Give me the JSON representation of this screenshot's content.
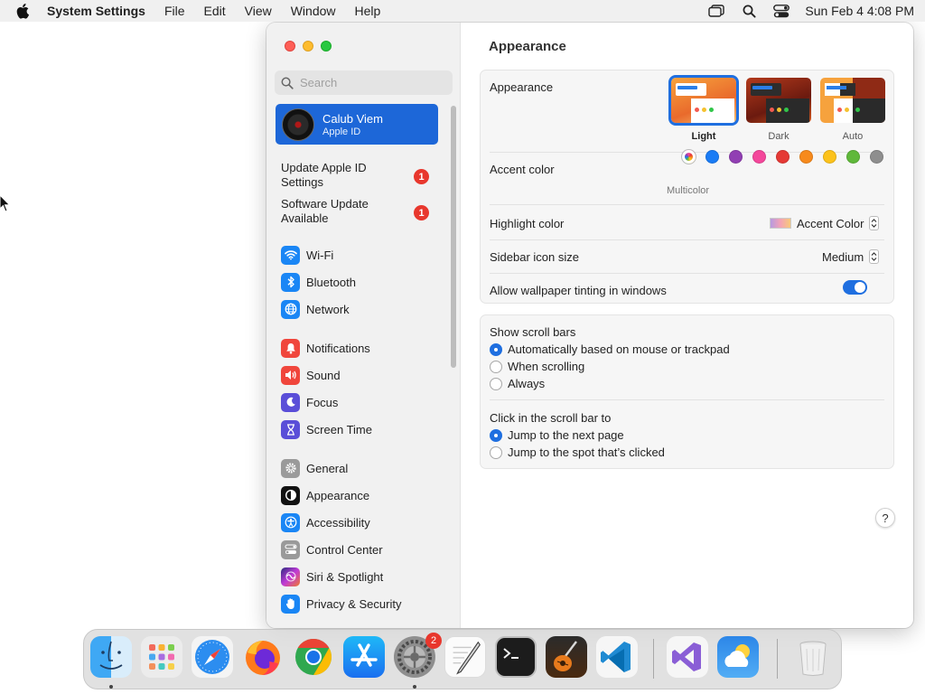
{
  "menubar": {
    "app_name": "System Settings",
    "menus": [
      "File",
      "Edit",
      "View",
      "Window",
      "Help"
    ],
    "clock": "Sun Feb 4  4:08 PM"
  },
  "sidebar": {
    "search_placeholder": "Search",
    "account": {
      "name": "Calub Viem",
      "subtitle": "Apple ID"
    },
    "notices": [
      {
        "label": "Update Apple ID Settings",
        "badge": "1"
      },
      {
        "label": "Software Update Available",
        "badge": "1"
      }
    ],
    "items": [
      {
        "label": "Wi-Fi",
        "icon": "wifi-icon",
        "color": "#1a86f5"
      },
      {
        "label": "Bluetooth",
        "icon": "bluetooth-icon",
        "color": "#1a86f5"
      },
      {
        "label": "Network",
        "icon": "network-icon",
        "color": "#1a86f5"
      },
      {
        "label": "Notifications",
        "icon": "bell-icon",
        "color": "#f0463c"
      },
      {
        "label": "Sound",
        "icon": "speaker-icon",
        "color": "#f0463c"
      },
      {
        "label": "Focus",
        "icon": "moon-icon",
        "color": "#5a4ed8"
      },
      {
        "label": "Screen Time",
        "icon": "hourglass-icon",
        "color": "#5a4ed8"
      },
      {
        "label": "General",
        "icon": "gear-icon",
        "color": "#9a9a9a"
      },
      {
        "label": "Appearance",
        "icon": "appearance-icon",
        "color": "#111111"
      },
      {
        "label": "Accessibility",
        "icon": "accessibility-icon",
        "color": "#1a86f5"
      },
      {
        "label": "Control Center",
        "icon": "control-center-icon",
        "color": "#9a9a9a"
      },
      {
        "label": "Siri & Spotlight",
        "icon": "siri-icon",
        "color": "#c03ad6"
      },
      {
        "label": "Privacy & Security",
        "icon": "hand-icon",
        "color": "#1a86f5"
      }
    ]
  },
  "main": {
    "title": "Appearance",
    "appearance": {
      "label": "Appearance",
      "options": [
        "Light",
        "Dark",
        "Auto"
      ],
      "selected": "Light"
    },
    "accent": {
      "label": "Accent color",
      "selected_label": "Multicolor",
      "colors": [
        "#1a7cf5",
        "#913fb3",
        "#f4479b",
        "#e53935",
        "#f78a1c",
        "#fcc21b",
        "#5fb83a",
        "#8e8e8e"
      ]
    },
    "highlight": {
      "label": "Highlight color",
      "value": "Accent Color"
    },
    "icon_size": {
      "label": "Sidebar icon size",
      "value": "Medium"
    },
    "tinting": {
      "label": "Allow wallpaper tinting in windows",
      "enabled": true
    },
    "scroll_bars": {
      "label": "Show scroll bars",
      "options": [
        "Automatically based on mouse or trackpad",
        "When scrolling",
        "Always"
      ],
      "selected": 0
    },
    "click_scroll": {
      "label": "Click in the scroll bar to",
      "options": [
        "Jump to the next page",
        "Jump to the spot that’s clicked"
      ],
      "selected": 0
    },
    "help": "?"
  },
  "dock": {
    "apps": [
      "finder-icon",
      "launchpad-icon",
      "safari-icon",
      "firefox-icon",
      "chrome-icon",
      "app-store-icon",
      "system-settings-icon",
      "textedit-icon",
      "terminal-icon",
      "garageband-icon",
      "vscode-icon",
      "visual-studio-icon",
      "weather-icon",
      "trash-icon"
    ],
    "settings_badge": "2"
  }
}
